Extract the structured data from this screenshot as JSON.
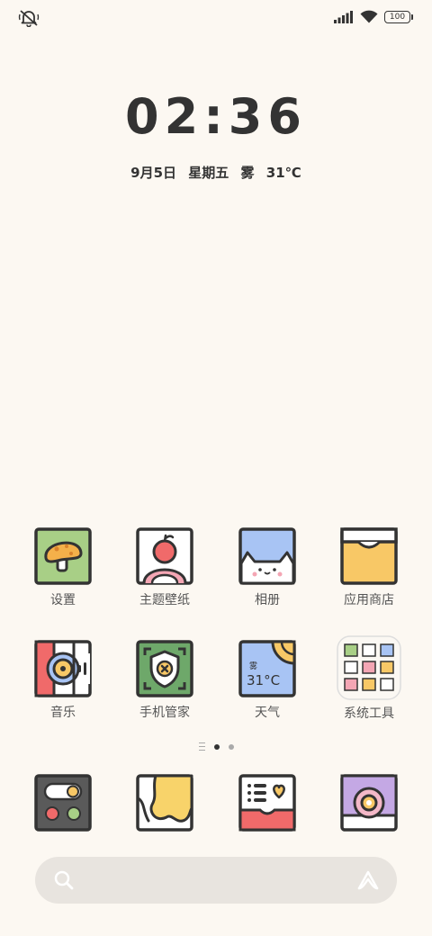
{
  "status_bar": {
    "battery_level": "100",
    "icons": [
      "notifications-muted-icon",
      "signal-icon",
      "wifi-icon",
      "battery-icon"
    ]
  },
  "lock": {
    "time": "02:36",
    "date": "9月5日",
    "weekday": "星期五",
    "weather": "雾",
    "temperature": "31℃"
  },
  "apps": [
    {
      "label": "设置",
      "icon": "mushroom-icon"
    },
    {
      "label": "主题壁纸",
      "icon": "apple-icon"
    },
    {
      "label": "相册",
      "icon": "cat-icon"
    },
    {
      "label": "应用商店",
      "icon": "box-icon"
    },
    {
      "label": "音乐",
      "icon": "music-disc-icon"
    },
    {
      "label": "手机管家",
      "icon": "shield-icon"
    },
    {
      "label": "天气",
      "icon": "weather-icon"
    },
    {
      "label": "系统工具",
      "icon": "folder-icon"
    }
  ],
  "weather_icon_text": {
    "condition": "雾",
    "temp": "31°C"
  },
  "pager": {
    "pages": 2,
    "active": 1
  },
  "dock": [
    {
      "icon": "phone-icon"
    },
    {
      "icon": "browser-icon"
    },
    {
      "icon": "messages-icon"
    },
    {
      "icon": "camera-icon"
    }
  ],
  "colors": {
    "background": "#fcf8f2",
    "outline": "#333333",
    "green": "#a8cf86",
    "pink": "#f4a6b4",
    "red": "#f06a6a",
    "yellow": "#f8c866",
    "blue": "#a8c4f4",
    "purple": "#c4a8e4"
  }
}
